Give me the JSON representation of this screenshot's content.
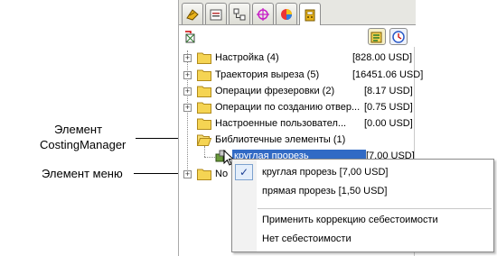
{
  "callouts": {
    "costing_manager_line1": "Элемент",
    "costing_manager_line2": "CostingManager",
    "menu_item": "Элемент меню"
  },
  "tabs": [
    {
      "icon": "feature-manager-icon"
    },
    {
      "icon": "property-manager-icon"
    },
    {
      "icon": "configuration-manager-icon"
    },
    {
      "icon": "dimxpert-manager-icon"
    },
    {
      "icon": "display-manager-icon"
    },
    {
      "icon": "costing-manager-icon",
      "active": true
    }
  ],
  "toolbar": {
    "left_icon": "costing-template-icon",
    "right_icons": [
      "costing-options-icon",
      "costing-clock-icon"
    ]
  },
  "tree": [
    {
      "label": "Настройка (4)",
      "cost": "[828.00 USD]"
    },
    {
      "label": "Траектория выреза (5)",
      "cost": "[16451.06 USD]"
    },
    {
      "label": "Операции фрезеровки (2)",
      "cost": "[8.17 USD]"
    },
    {
      "label": "Операции по созданию отвер...",
      "cost": "[0.75 USD]"
    },
    {
      "label": "Настроенные пользовател...",
      "cost": "[0.00 USD]"
    },
    {
      "label": "Библиотечные элементы (1)",
      "cost": ""
    },
    {
      "label": "круглая прорезь",
      "cost": "[7.00 USD]",
      "selected": true
    },
    {
      "label": "No",
      "cost": ""
    }
  ],
  "context_menu": {
    "items": [
      "круглая прорезь [7,00 USD]",
      "прямая прорезь [1,50 USD]",
      "Применить коррекцию себестоимости",
      "Нет себестоимости"
    ]
  },
  "colors": {
    "selection": "#316ac5",
    "folder": "#f5d453",
    "tab_bar": "#e7e7e2"
  }
}
